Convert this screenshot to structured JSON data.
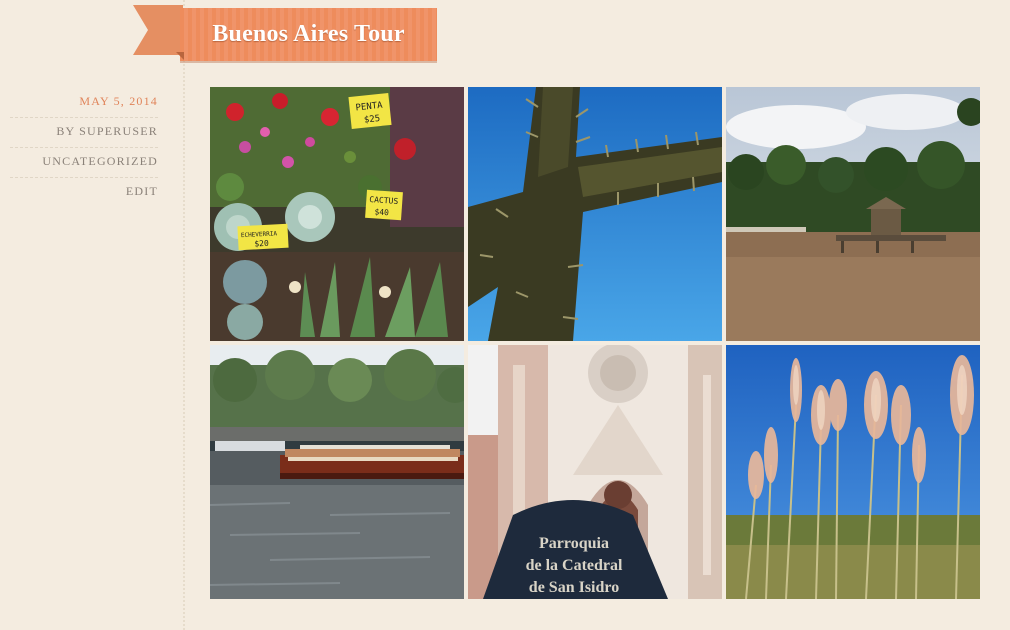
{
  "post": {
    "title": "Buenos Aires Tour",
    "date": "May 5, 2014",
    "author": "by superuser",
    "category": "Uncategorized",
    "edit": "Edit"
  },
  "gallery": {
    "photos": [
      {
        "name": "flowers-market-photo",
        "signs": [
          "PENTA",
          "$25",
          "CACTUS",
          "$40",
          "ECHEVERRIA",
          "$20"
        ]
      },
      {
        "name": "cactus-sky-photo"
      },
      {
        "name": "river-dock-photo"
      },
      {
        "name": "boat-harbor-photo"
      },
      {
        "name": "cathedral-photo",
        "sign": [
          "Parroquia",
          "de la Catedral",
          "de San Isidro"
        ]
      },
      {
        "name": "pampas-grass-photo"
      }
    ]
  },
  "colors": {
    "accent": "#ee8c5c",
    "background": "#f4ece0",
    "meta_text": "#8a8178"
  }
}
